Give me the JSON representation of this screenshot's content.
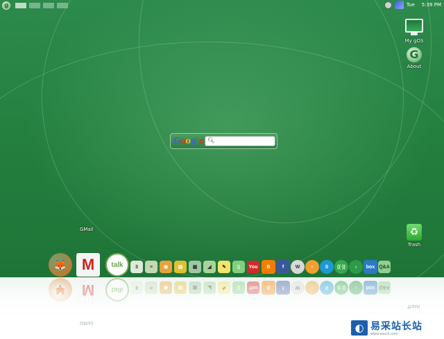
{
  "topbar": {
    "menu_icon": "gos-g-icon",
    "workspaces": 4,
    "day": "Tue",
    "time": "5:39 PM",
    "tray_icons": [
      "network-icon",
      "wifi-icon"
    ]
  },
  "desktop_icons": {
    "mygos": {
      "label": "My gOS",
      "icon": "monitor-icon"
    },
    "about": {
      "label": "About",
      "icon": "green-g-icon"
    },
    "trash": {
      "label": "Trash",
      "icon": "recycle-bin-icon"
    }
  },
  "search": {
    "logo": "Google",
    "placeholder": "",
    "value": ""
  },
  "dock": {
    "hover_label": "GMail",
    "big": [
      {
        "id": "firefox",
        "name": "Firefox",
        "glyph": "🦊",
        "color": "#e06a12"
      },
      {
        "id": "gmail",
        "name": "GMail",
        "glyph": "M",
        "color": "#c8241c"
      },
      {
        "id": "gtalk",
        "name": "Google Talk",
        "glyph": "talk",
        "color": "#6aa84f"
      }
    ],
    "small": [
      {
        "id": "calendar",
        "glyph": "3",
        "color": "#dfe9d9"
      },
      {
        "id": "docs",
        "glyph": "≡",
        "color": "#c4d8b4"
      },
      {
        "id": "reader",
        "glyph": "◉",
        "color": "#e8a33a"
      },
      {
        "id": "notebook",
        "glyph": "▤",
        "color": "#e0c030"
      },
      {
        "id": "photos",
        "glyph": "▦",
        "color": "#9ec7a4"
      },
      {
        "id": "maps",
        "glyph": "◢",
        "color": "#a7d49a"
      },
      {
        "id": "notes",
        "glyph": "✎",
        "color": "#f2e36a"
      },
      {
        "id": "book",
        "glyph": "▯",
        "color": "#7fcf7f"
      },
      {
        "id": "youtube",
        "glyph": "You",
        "color": "#d42a2a"
      },
      {
        "id": "blogger",
        "glyph": "B",
        "color": "#f57d00"
      },
      {
        "id": "facebook",
        "glyph": "f",
        "color": "#3b5998"
      },
      {
        "id": "wikipedia",
        "glyph": "W",
        "color": "#d9d9d9"
      },
      {
        "id": "meebo",
        "glyph": "♀",
        "color": "#f0a030"
      },
      {
        "id": "skype",
        "glyph": "S",
        "color": "#1c9ad6"
      },
      {
        "id": "wifi",
        "glyph": "((·))",
        "color": "#35a84e"
      },
      {
        "id": "music",
        "glyph": "♪",
        "color": "#2f9a4a"
      },
      {
        "id": "box",
        "glyph": "box",
        "color": "#2a7ac4"
      },
      {
        "id": "qa",
        "glyph": "Q&A",
        "color": "#8fd18f"
      }
    ]
  },
  "watermark": {
    "title": "易采站长站",
    "url": "www.easck.com"
  }
}
